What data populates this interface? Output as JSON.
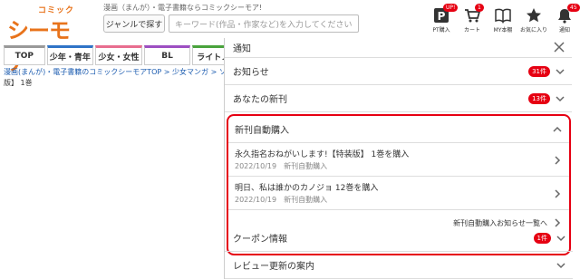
{
  "header": {
    "logo_small": "コミック",
    "logo_big": "シーモア",
    "tagline": "漫画（まんが）・電子書籍ならコミックシーモア!",
    "genre_button": "ジャンルで探す",
    "search_placeholder": "キーワード(作品・作家など)を入力してください",
    "icons": [
      {
        "label": "PT購入",
        "badge": "UP!"
      },
      {
        "label": "カート",
        "badge": "1"
      },
      {
        "label": "MY本棚",
        "badge": ""
      },
      {
        "label": "お気に入り",
        "badge": ""
      },
      {
        "label": "通知",
        "badge": "45"
      }
    ]
  },
  "tabs": [
    "TOP",
    "少年・青年",
    "少女・女性",
    "BL",
    "ライトノ"
  ],
  "breadcrumb": "漫画(まんが)・電子書籍のコミックシーモアTOP > 少女マンガ > ソ",
  "breadcrumb_tail": "版】 1巻",
  "panel": {
    "title": "通知",
    "rows": [
      {
        "label": "お知らせ",
        "count": "31件"
      },
      {
        "label": "あなたの新刊",
        "count": "13件"
      }
    ],
    "auto": {
      "title": "新刊自動購入",
      "items": [
        {
          "title": "永久指名おねがいします!【特装版】 1巻を購入",
          "date": "2022/10/19",
          "status": "新刊自動購入"
        },
        {
          "title": "明日、私は誰かのカノジョ 12巻を購入",
          "date": "2022/10/19",
          "status": "新刊自動購入"
        }
      ],
      "more": "新刊自動購入お知らせ一覧へ"
    },
    "bottom_rows": [
      {
        "label": "クーポン情報",
        "count": "1件"
      },
      {
        "label": "レビュー更新の案内",
        "count": ""
      }
    ]
  },
  "colors": {
    "accent": "#e8731b",
    "alert": "#e60012"
  }
}
